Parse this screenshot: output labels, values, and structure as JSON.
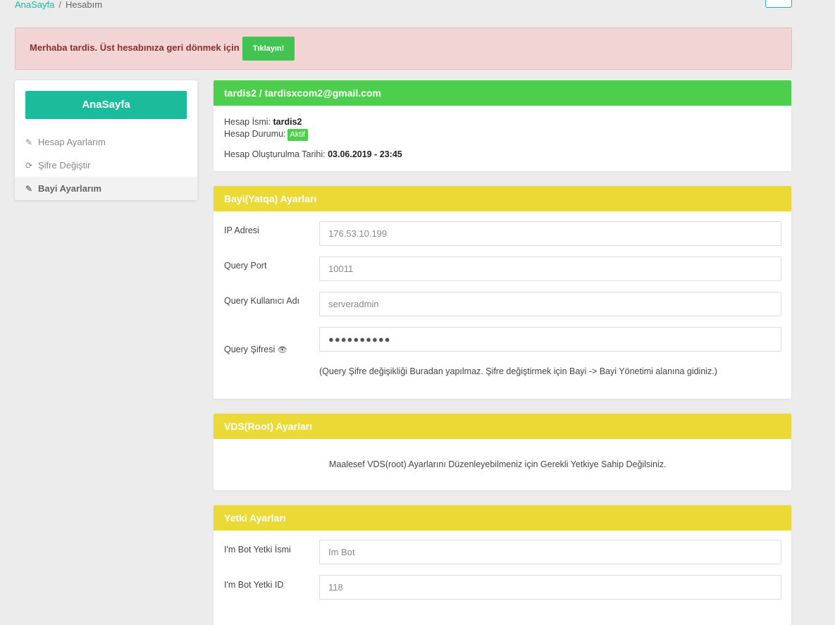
{
  "breadcrumb": {
    "home": "AnaSayfa",
    "separator": "/",
    "current": "Hesabım"
  },
  "alert": {
    "text": "Merhaba tardis. Üst hesabınıza geri dönmek için",
    "button": "Tıklayın!"
  },
  "sidebar": {
    "main_button": "AnaSayfa",
    "items": [
      {
        "label": "Hesap Ayarlarım",
        "icon": "edit-icon",
        "glyph": "✎"
      },
      {
        "label": "Şifre Değiştir",
        "icon": "refresh-icon",
        "glyph": "⟳"
      },
      {
        "label": "Bayi Ayarlarım",
        "icon": "edit-icon",
        "glyph": "✎"
      }
    ]
  },
  "account": {
    "header": "tardis2 / tardisxcom2@gmail.com",
    "name_label": "Hesap İsmi:",
    "name_value": "tardis2",
    "status_label": "Hesap Durumu:",
    "status_value": "Aktif",
    "created_label": "Hesap Oluşturulma Tarihi:",
    "created_value": "03.06.2019 - 23:45"
  },
  "reseller": {
    "header": "Bayi(Yatqa) Ayarları",
    "ip_label": "IP Adresi",
    "ip_value": "176.53.10.199",
    "port_label": "Query Port",
    "port_value": "10011",
    "user_label": "Query Kullanıcı Adı",
    "user_value": "serveradmin",
    "pass_label": "Query Şifresi",
    "pass_value": "●●●●●●●●●●",
    "note": "(Query Şifre değişikliği Buradan yapılmaz. Şifre değiştirmek için Bayi -> Bayi Yönetimi alanına gidiniz.)"
  },
  "vds": {
    "header": "VDS(Root) Ayarları",
    "message": "Maalesef VDS(root) Ayarlarını Düzenleyebilmeniz için Gerekli Yetkiye Sahip Değilsiniz."
  },
  "permissions": {
    "header": "Yetki Ayarları",
    "bot_name_label": "I'm Bot Yetki İsmi",
    "bot_name_value": "Im Bot",
    "bot_id_label": "I'm Bot Yetki ID",
    "bot_id_value": "118"
  },
  "colors": {
    "accent": "#1abc9c",
    "green": "#4dcf4d",
    "yellow": "#ebd936",
    "alert_bg": "#f2d4d4"
  }
}
